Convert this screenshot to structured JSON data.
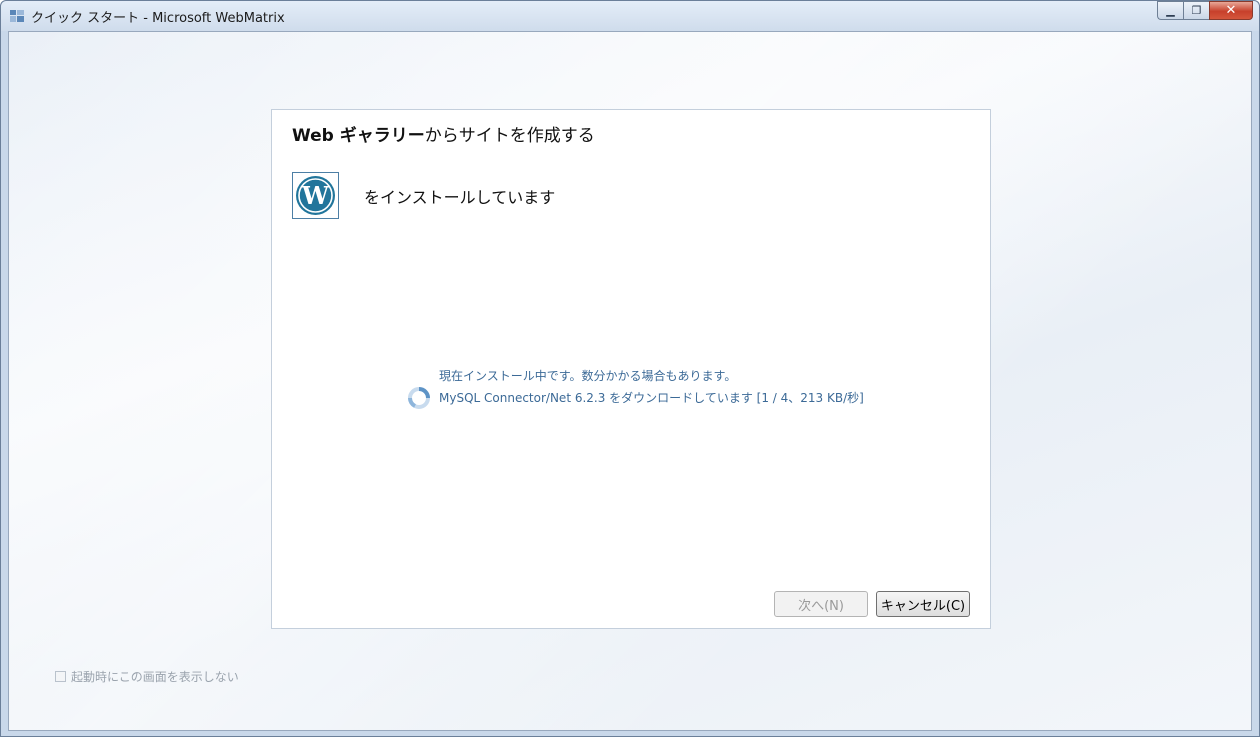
{
  "window": {
    "title": "クイック スタート - Microsoft WebMatrix",
    "minimize_glyph": "▁",
    "maximize_glyph": "❐",
    "close_glyph": "✕"
  },
  "panel": {
    "title_bold": "Web ギャラリー",
    "title_rest": "からサイトを作成する",
    "app_icon": "wordpress-logo",
    "install_text": "をインストールしています",
    "status_line_1": "現在インストール中です。数分かかる場合もあります。",
    "status_line_2": "MySQL Connector/Net 6.2.3 をダウンロードしています [1 / 4、213 KB/秒]",
    "buttons": {
      "next": "次へ(N)",
      "cancel": "キャンセル(C)"
    }
  },
  "startup_checkbox": {
    "label": "起動時にこの画面を表示しない",
    "checked": false
  },
  "colors": {
    "status_text": "#3c6a97",
    "wordpress_blue": "#21759b"
  }
}
